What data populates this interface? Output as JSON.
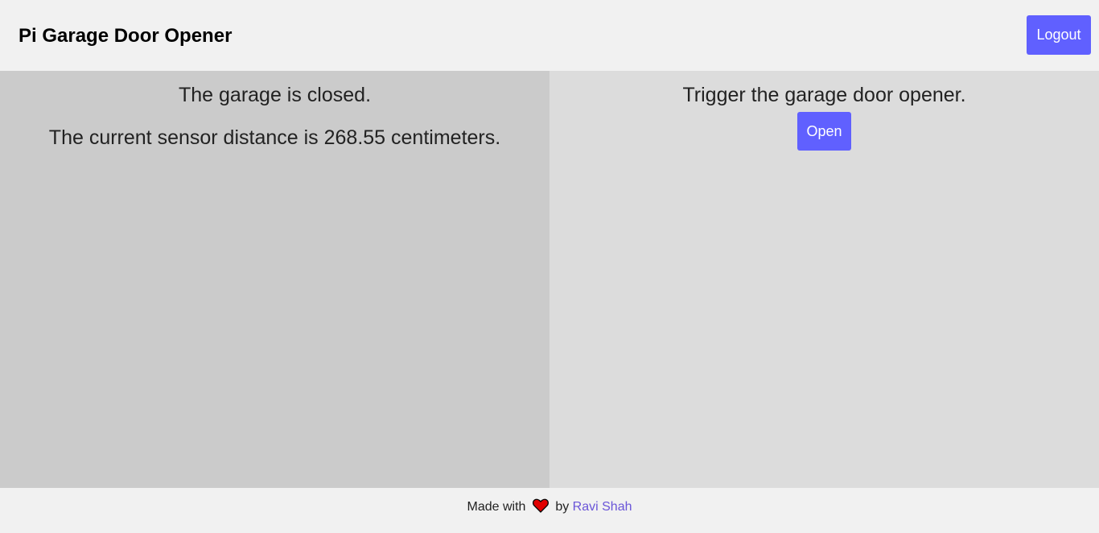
{
  "header": {
    "title": "Pi Garage Door Opener",
    "logout_label": "Logout"
  },
  "status_panel": {
    "status_text": "The garage is closed.",
    "distance_text": "The current sensor distance is 268.55 centimeters."
  },
  "control_panel": {
    "prompt_text": "Trigger the garage door opener.",
    "open_label": "Open"
  },
  "footer": {
    "made_with": "Made with",
    "by": "by",
    "author": "Ravi Shah",
    "icon": "heart-icon"
  },
  "colors": {
    "accent": "#6060ff",
    "link": "#6a55d8",
    "heart": "#e00000"
  }
}
